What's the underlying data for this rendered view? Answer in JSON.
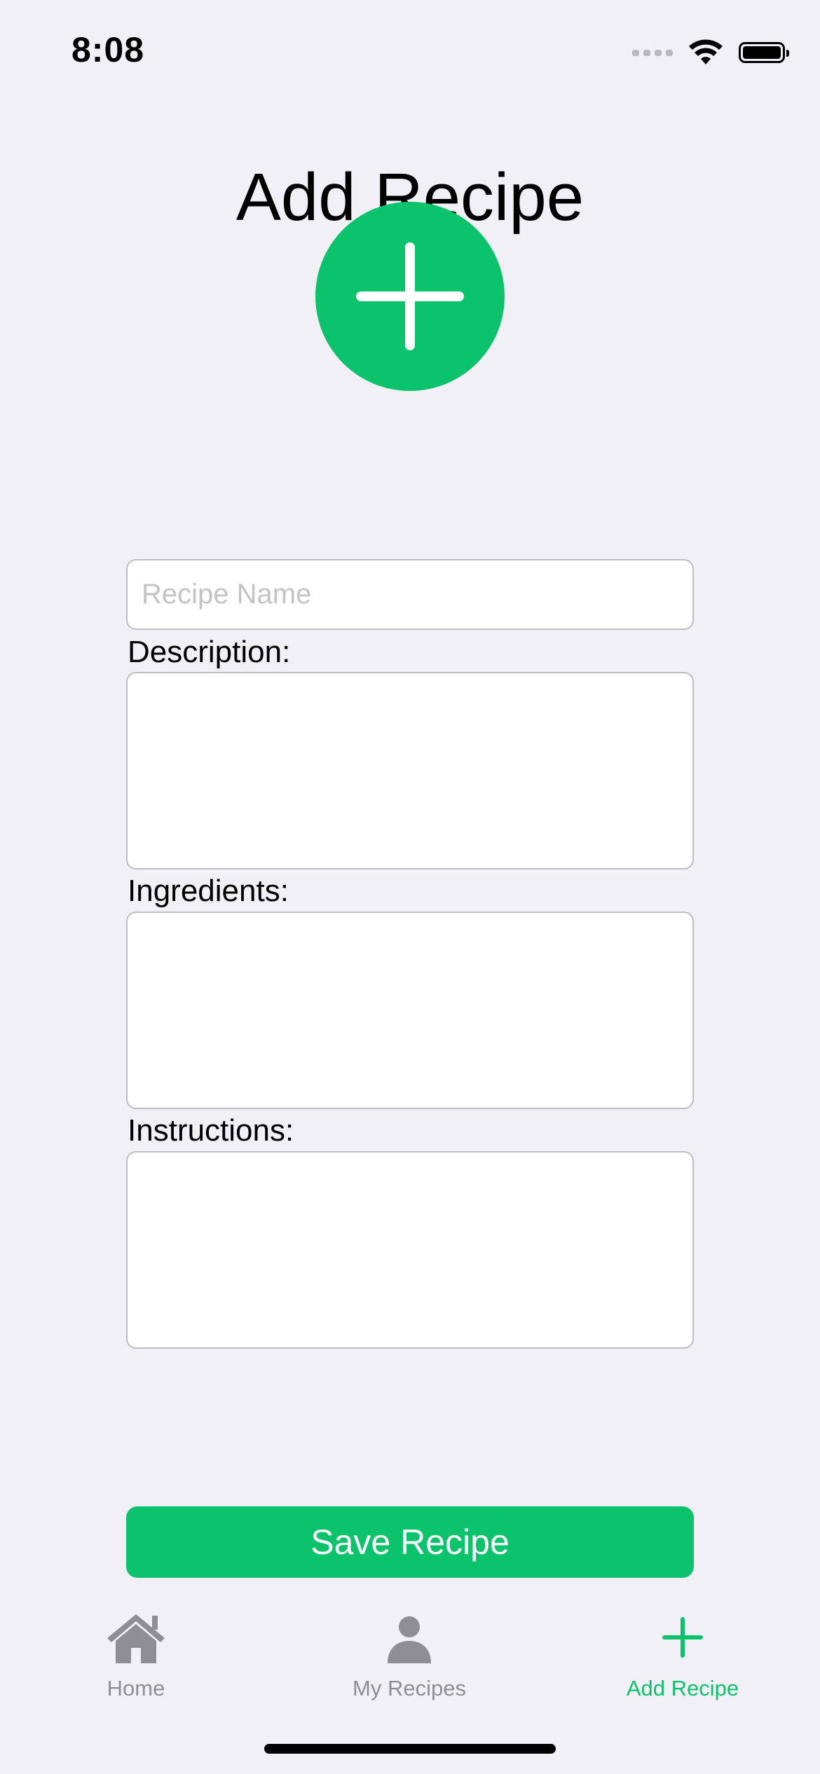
{
  "status_bar": {
    "time": "8:08",
    "icons": [
      "cellular-signal-icon",
      "wifi-icon",
      "battery-icon"
    ]
  },
  "page": {
    "title": "Add Recipe"
  },
  "image_picker": {
    "icon": "plus-icon",
    "color": "#0BC36A"
  },
  "form": {
    "recipe_name": {
      "value": "",
      "placeholder": "Recipe Name"
    },
    "description": {
      "label": "Description:",
      "value": ""
    },
    "ingredients": {
      "label": "Ingredients:",
      "value": ""
    },
    "instructions": {
      "label": "Instructions:",
      "value": ""
    },
    "save_label": "Save Recipe"
  },
  "tab_bar": {
    "items": [
      {
        "label": "Home",
        "icon": "house-icon",
        "selected": false
      },
      {
        "label": "My Recipes",
        "icon": "person-icon",
        "selected": false
      },
      {
        "label": "Add Recipe",
        "icon": "plus-icon",
        "selected": true
      }
    ],
    "active_color": "#0BC36A",
    "inactive_color": "#8E8E93"
  },
  "colors": {
    "accent": "#0BC36A",
    "background": "#F1F0F6",
    "field_border": "#BDBDC2"
  }
}
